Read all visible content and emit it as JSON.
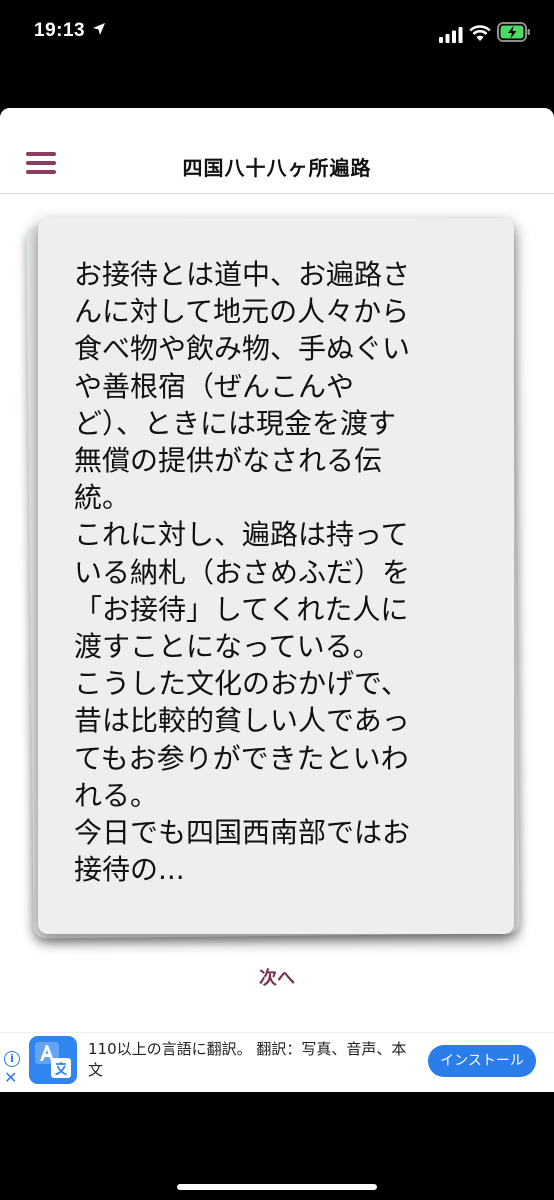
{
  "status_bar": {
    "time": "19:13"
  },
  "navbar": {
    "title": "四国八十八ヶ所遍路",
    "menu_icon": "hamburger-menu-icon",
    "accent_color": "#8a3d5c"
  },
  "card": {
    "text": "お接待とは道中、お遍路さ\nんに対して地元の人々から\n食べ物や飲み物、手ぬぐい\nや善根宿（ぜんこんや\nど）、ときには現金を渡す\n無償の提供がなされる伝\n統。\nこれに対し、遍路は持って\nいる納札（おさめふだ）を\n「お接待」してくれた人に\n渡すことになっている。\nこうした文化のおかげで、\n昔は比較的貧しい人であっ\nてもお参りができたといわ\nれる。\n今日でも四国西南部ではお\n接待の..."
  },
  "next_label": "次へ",
  "ad": {
    "text": "110以上の言語に翻訳。 翻訳：写真、音声、本文",
    "install_label": "インストール",
    "accent_color": "#2b7de9"
  }
}
